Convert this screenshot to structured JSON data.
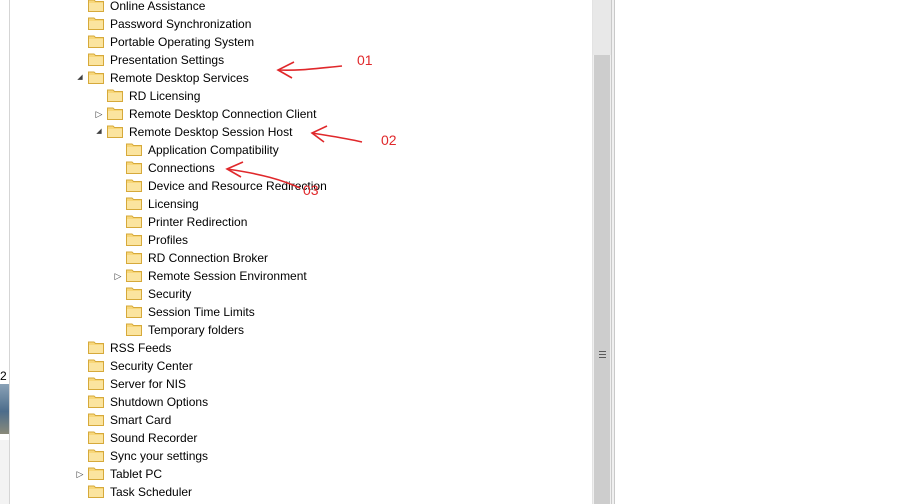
{
  "colors": {
    "folder_fill": "#f8d77a",
    "folder_edge": "#d6a93a",
    "annotation": "#e0282b",
    "scroll_thumb": "#cdcdcd"
  },
  "left_edge": {
    "peek_number": "2"
  },
  "tree": {
    "items": [
      {
        "label": "Online Assistance",
        "level": 0,
        "expander": "none"
      },
      {
        "label": "Password Synchronization",
        "level": 0,
        "expander": "none"
      },
      {
        "label": "Portable Operating System",
        "level": 0,
        "expander": "none"
      },
      {
        "label": "Presentation Settings",
        "level": 0,
        "expander": "none"
      },
      {
        "label": "Remote Desktop Services",
        "level": 0,
        "expander": "expanded"
      },
      {
        "label": "RD Licensing",
        "level": 1,
        "expander": "none"
      },
      {
        "label": "Remote Desktop Connection Client",
        "level": 1,
        "expander": "collapsed"
      },
      {
        "label": "Remote Desktop Session Host",
        "level": 1,
        "expander": "expanded"
      },
      {
        "label": "Application Compatibility",
        "level": 2,
        "expander": "none"
      },
      {
        "label": "Connections",
        "level": 2,
        "expander": "none"
      },
      {
        "label": "Device and Resource Redirection",
        "level": 2,
        "expander": "none"
      },
      {
        "label": "Licensing",
        "level": 2,
        "expander": "none"
      },
      {
        "label": "Printer Redirection",
        "level": 2,
        "expander": "none"
      },
      {
        "label": "Profiles",
        "level": 2,
        "expander": "none"
      },
      {
        "label": "RD Connection Broker",
        "level": 2,
        "expander": "none"
      },
      {
        "label": "Remote Session Environment",
        "level": 2,
        "expander": "collapsed"
      },
      {
        "label": "Security",
        "level": 2,
        "expander": "none"
      },
      {
        "label": "Session Time Limits",
        "level": 2,
        "expander": "none"
      },
      {
        "label": "Temporary folders",
        "level": 2,
        "expander": "none"
      },
      {
        "label": "RSS Feeds",
        "level": 0,
        "expander": "none"
      },
      {
        "label": "Security Center",
        "level": 0,
        "expander": "none"
      },
      {
        "label": "Server for NIS",
        "level": 0,
        "expander": "none"
      },
      {
        "label": "Shutdown Options",
        "level": 0,
        "expander": "none"
      },
      {
        "label": "Smart Card",
        "level": 0,
        "expander": "none"
      },
      {
        "label": "Sound Recorder",
        "level": 0,
        "expander": "none"
      },
      {
        "label": "Sync your settings",
        "level": 0,
        "expander": "none"
      },
      {
        "label": "Tablet PC",
        "level": 0,
        "expander": "collapsed"
      },
      {
        "label": "Task Scheduler",
        "level": 0,
        "expander": "none"
      }
    ]
  },
  "annotations": [
    {
      "label": "01",
      "target": "Remote Desktop Services"
    },
    {
      "label": "02",
      "target": "Remote Desktop Session Host"
    },
    {
      "label": "03",
      "target": "Connections"
    }
  ],
  "icons": {
    "folder": "folder-icon",
    "expanded": "expanded-triangle-icon",
    "collapsed": "collapsed-triangle-icon",
    "grip": "scroll-grip-icon",
    "arrow": "red-arrow-icon"
  }
}
